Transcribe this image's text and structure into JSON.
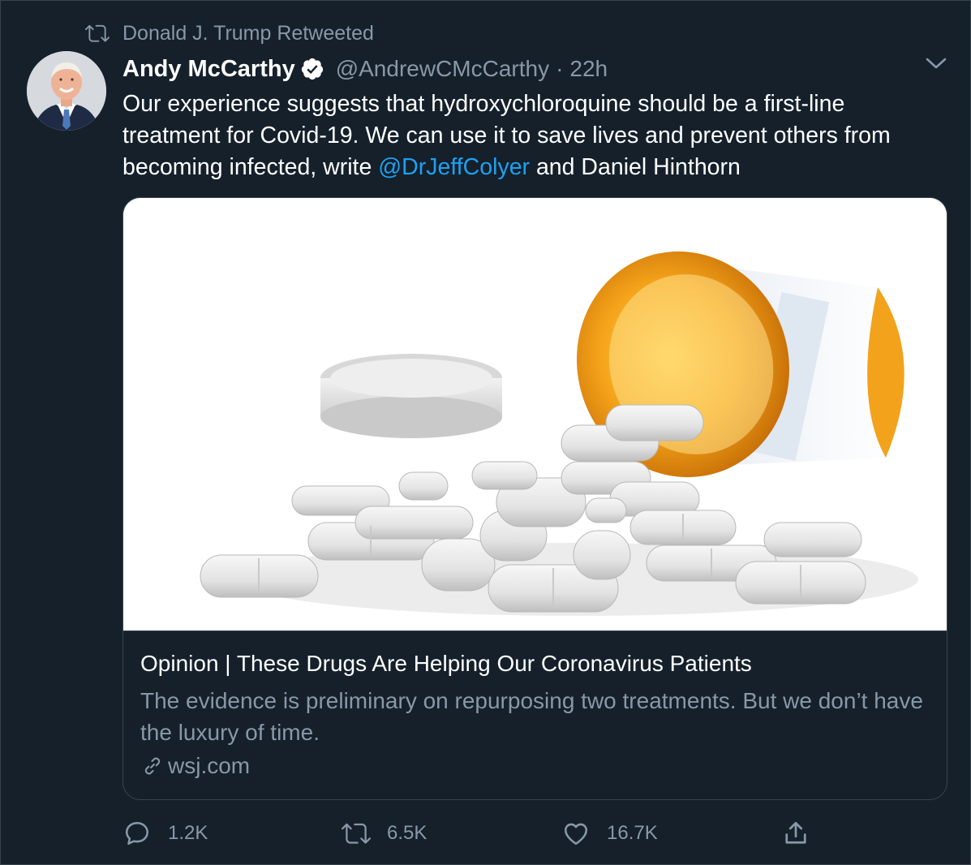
{
  "retweet_context": {
    "text": "Donald J. Trump Retweeted",
    "icon": "retweet-icon"
  },
  "author": {
    "display_name": "Andy McCarthy",
    "verified": true,
    "handle": "@AndrewCMcCarthy",
    "separator": "·",
    "time": "22h"
  },
  "tweet": {
    "text_before_mention": "Our experience suggests that hydroxychloroquine should be a first-line treatment for Covid-19. We can use it to save lives and prevent others from becoming infected, write ",
    "mention": "@DrJeffColyer",
    "text_after_mention": " and Daniel Hinthorn"
  },
  "card": {
    "title": "Opinion | These Drugs Are Helping Our Coronavirus Patients",
    "description": "The evidence is preliminary on repurposing two treatments. But we don’t have the luxury of time.",
    "domain": "wsj.com",
    "image_subject": "spilled pill bottle with white tablets"
  },
  "actions": {
    "replies": "1.2K",
    "retweets": "6.5K",
    "likes": "16.7K"
  },
  "colors": {
    "background": "#15202b",
    "border": "#38444d",
    "secondary_text": "#8899a6",
    "link": "#1da1f2",
    "primary_text": "#ffffff"
  }
}
